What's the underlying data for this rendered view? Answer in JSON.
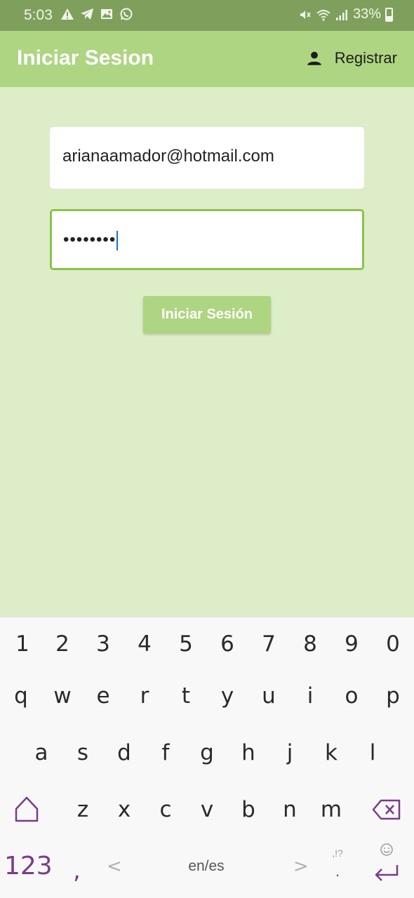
{
  "status_bar": {
    "time": "5:03",
    "battery": "33%",
    "icons": [
      "alert-icon",
      "telegram-icon",
      "gallery-icon",
      "whatsapp-icon",
      "mute-icon",
      "wifi-icon",
      "signal-icon",
      "battery-icon"
    ]
  },
  "app_bar": {
    "title": "Iniciar Sesion",
    "register_label": "Registrar",
    "register_icon": "person-icon"
  },
  "form": {
    "email_value": "arianaamador@hotmail.com",
    "password_value": "••••••••",
    "login_button": "Iniciar Sesión"
  },
  "keyboard": {
    "numbers": [
      "1",
      "2",
      "3",
      "4",
      "5",
      "6",
      "7",
      "8",
      "9",
      "0"
    ],
    "row_q": [
      "q",
      "w",
      "e",
      "r",
      "t",
      "y",
      "u",
      "i",
      "o",
      "p"
    ],
    "row_a": [
      "a",
      "s",
      "d",
      "f",
      "g",
      "h",
      "j",
      "k",
      "l"
    ],
    "row_z": [
      "z",
      "x",
      "c",
      "v",
      "b",
      "n",
      "m"
    ],
    "symbols_key": "123",
    "comma_key": ",",
    "lang_label": "en/es",
    "arrow_left": "<",
    "arrow_right": ">",
    "punct_top": ",!?",
    "punct_bottom": "."
  },
  "colors": {
    "status_bar": "#7fa05c",
    "app_bar": "#aed581",
    "background": "#dcedc8",
    "focus_border": "#8bc34a",
    "keyboard_accent": "#7a3a8c"
  }
}
